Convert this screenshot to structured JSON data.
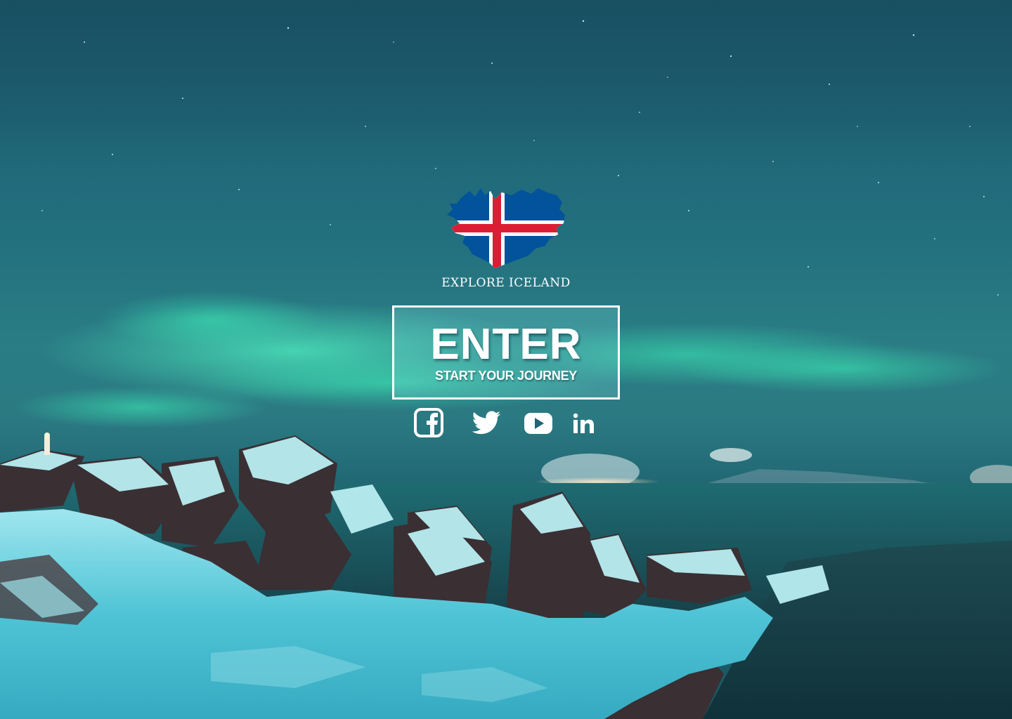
{
  "brand": {
    "name": "EXPLORE ICELAND",
    "flag_colors": {
      "blue": "#02529C",
      "white": "#FFFFFF",
      "red": "#DC1E35"
    }
  },
  "cta": {
    "title": "ENTER",
    "subtitle": "START YOUR JOURNEY"
  },
  "social": [
    {
      "name": "Facebook",
      "icon": "facebook-icon"
    },
    {
      "name": "Twitter",
      "icon": "twitter-icon"
    },
    {
      "name": "YouTube",
      "icon": "youtube-icon"
    },
    {
      "name": "LinkedIn",
      "icon": "linkedin-icon"
    }
  ],
  "theme": {
    "sky": "#1f6678",
    "aurora": "#3fd9b0",
    "snow": "#d8f4f6"
  }
}
